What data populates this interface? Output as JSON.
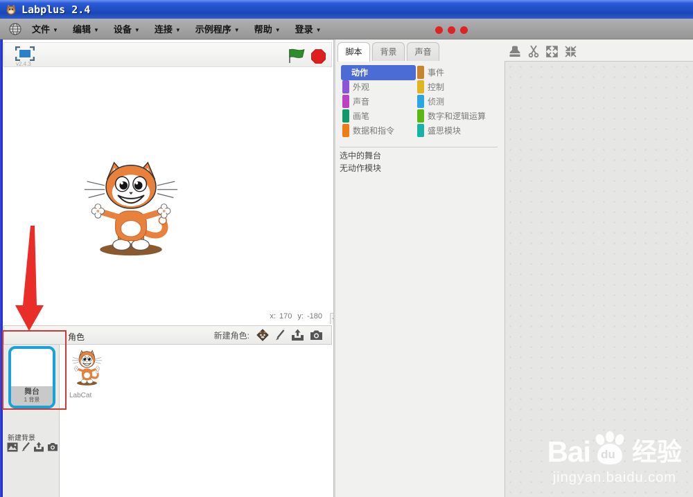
{
  "window": {
    "title": "Labplus 2.4"
  },
  "menubar": {
    "items": [
      "文件",
      "编辑",
      "设备",
      "连接",
      "示例程序",
      "帮助",
      "登录"
    ]
  },
  "stage": {
    "version": "v2.4.3",
    "coords": {
      "x_label": "x:",
      "x_value": "170",
      "y_label": "y:",
      "y_value": "-180"
    }
  },
  "sprite_panel": {
    "header": "角色",
    "new_sprite_label": "新建角色:",
    "stage_thumb_title": "舞台",
    "stage_thumb_subtitle": "1 背景",
    "new_backdrop_label": "新建背景",
    "sprite_name": "LabCat"
  },
  "right_panel": {
    "tabs": [
      "脚本",
      "背景",
      "声音"
    ],
    "categories_col1": [
      {
        "label": "动作",
        "color": "#4a6cd4"
      },
      {
        "label": "外观",
        "color": "#8a55d7"
      },
      {
        "label": "声音",
        "color": "#bb42c3"
      },
      {
        "label": "画笔",
        "color": "#0e9a6c"
      },
      {
        "label": "数据和指令",
        "color": "#ee7d16"
      }
    ],
    "categories_col2": [
      {
        "label": "事件",
        "color": "#c88330"
      },
      {
        "label": "控制",
        "color": "#e0b520"
      },
      {
        "label": "侦测",
        "color": "#2ca5e2"
      },
      {
        "label": "数字和逻辑运算",
        "color": "#5cb712"
      },
      {
        "label": "盛思模块",
        "color": "#17b4a5"
      }
    ],
    "status_line1": "选中的舞台",
    "status_line2": "无动作模块"
  },
  "watermark": {
    "brand_left": "Bai",
    "brand_du": "du",
    "brand_suffix": "经验",
    "url": "jingyan.baidu.com"
  }
}
